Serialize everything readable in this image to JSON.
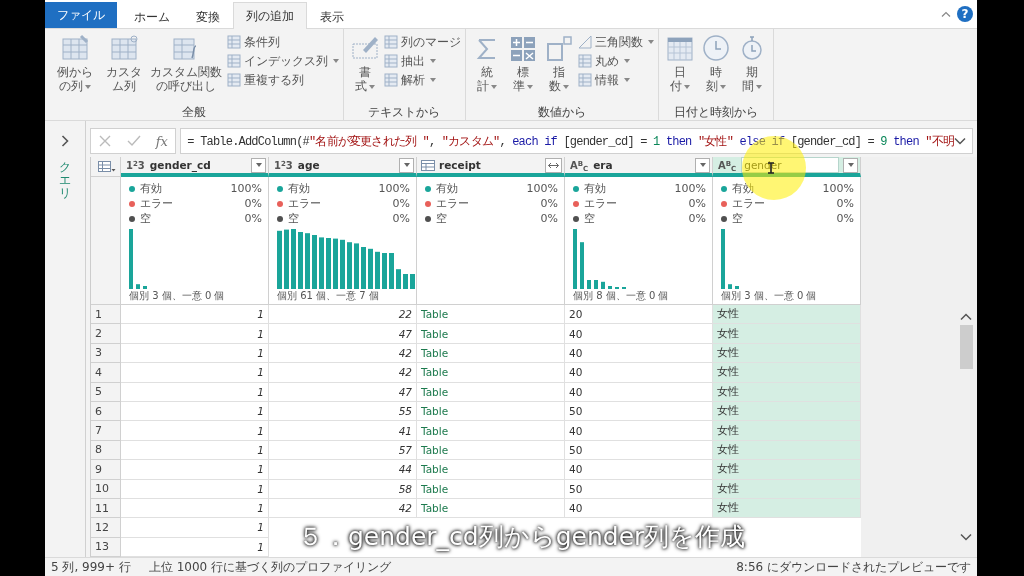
{
  "ribbon": {
    "tabs": [
      {
        "label": "ファイル",
        "kind": "file",
        "selected": false
      },
      {
        "label": "ホーム",
        "kind": "tab",
        "selected": false
      },
      {
        "label": "変換",
        "kind": "tab",
        "selected": false
      },
      {
        "label": "列の追加",
        "kind": "tab",
        "selected": true
      },
      {
        "label": "表示",
        "kind": "tab",
        "selected": false
      }
    ],
    "help_label": "?",
    "groups": [
      {
        "title": "全般",
        "items": [
          {
            "kind": "large",
            "label": "例からの列",
            "dropdown": true
          },
          {
            "kind": "large",
            "label": "カスタム列",
            "dropdown": false
          },
          {
            "kind": "large",
            "label": "カスタム関数の呼び出し",
            "dropdown": false
          },
          {
            "kind": "small",
            "label": "条件列",
            "dropdown": false
          },
          {
            "kind": "small",
            "label": "インデックス列",
            "dropdown": true
          },
          {
            "kind": "small",
            "label": "重複する列",
            "dropdown": false
          }
        ]
      },
      {
        "title": "テキストから",
        "items": [
          {
            "kind": "large",
            "label": "書式",
            "dropdown": true
          },
          {
            "kind": "small",
            "label": "列のマージ",
            "dropdown": false
          },
          {
            "kind": "small",
            "label": "抽出",
            "dropdown": true
          },
          {
            "kind": "small",
            "label": "解析",
            "dropdown": true
          }
        ]
      },
      {
        "title": "数値から",
        "items": [
          {
            "kind": "large",
            "label": "統計",
            "dropdown": true
          },
          {
            "kind": "large",
            "label": "標準",
            "dropdown": true
          },
          {
            "kind": "large",
            "label": "指数",
            "dropdown": true
          },
          {
            "kind": "small",
            "label": "三角関数",
            "dropdown": true
          },
          {
            "kind": "small",
            "label": "丸め",
            "dropdown": true
          },
          {
            "kind": "small",
            "label": "情報",
            "dropdown": true
          }
        ]
      },
      {
        "title": "日付と時刻から",
        "items": [
          {
            "kind": "large",
            "label": "日付",
            "dropdown": true
          },
          {
            "kind": "large",
            "label": "時刻",
            "dropdown": true
          },
          {
            "kind": "large",
            "label": "期間",
            "dropdown": true
          }
        ]
      }
    ]
  },
  "queries_pane": {
    "label": "クエリ"
  },
  "formula_bar": {
    "fx_label": "fx",
    "formula": "= Table.AddColumn(#\"名前が変更された列 \", \"カスタム\", each if [gender_cd] = 1 then \"女性\" else if [gender_cd] = 9 then \"不明"
  },
  "table": {
    "columns": [
      {
        "name": "gender_cd",
        "kind": "number",
        "type_label": "1$^{2}$3",
        "editing": false,
        "highlighted": false,
        "stats": [
          {
            "label": "有効",
            "value": "100%",
            "color": "#1aa59a"
          },
          {
            "label": "エラー",
            "value": "0%",
            "color": "#e8605a"
          },
          {
            "label": "空",
            "value": "0%",
            "color": "#505050"
          }
        ],
        "distinct": "個別 3 個、一意 0 個"
      },
      {
        "name": "age",
        "kind": "number",
        "type_label": "1$^{2}$3",
        "editing": false,
        "highlighted": false,
        "stats": [
          {
            "label": "有効",
            "value": "100%",
            "color": "#1aa59a"
          },
          {
            "label": "エラー",
            "value": "0%",
            "color": "#e8605a"
          },
          {
            "label": "空",
            "value": "0%",
            "color": "#505050"
          }
        ],
        "distinct": "個別 61 個、一意 7 個"
      },
      {
        "name": "receipt",
        "kind": "table",
        "editing": false,
        "highlighted": false,
        "stats": [
          {
            "label": "有効",
            "value": "100%",
            "color": "#1aa59a"
          },
          {
            "label": "エラー",
            "value": "0%",
            "color": "#e8605a"
          },
          {
            "label": "空",
            "value": "0%",
            "color": "#505050"
          }
        ]
      },
      {
        "name": "era",
        "kind": "text",
        "type_label": "A$^{B}$$_{C}$",
        "editing": false,
        "highlighted": false,
        "stats": [
          {
            "label": "有効",
            "value": "100%",
            "color": "#1aa59a"
          },
          {
            "label": "エラー",
            "value": "0%",
            "color": "#e8605a"
          },
          {
            "label": "空",
            "value": "0%",
            "color": "#505050"
          }
        ],
        "distinct": "個別 8 個、一意 0 個"
      },
      {
        "name": "gender",
        "kind": "text",
        "type_label": "A$^{B}$$_{C}$",
        "editing": true,
        "highlighted": true,
        "stats": [
          {
            "label": "有効",
            "value": "100%",
            "color": "#1aa59a"
          },
          {
            "label": "エラー",
            "value": "0%",
            "color": "#e8605a"
          },
          {
            "label": "空",
            "value": "0%",
            "color": "#505050"
          }
        ],
        "distinct": "個別 3 個、一意 0 個"
      }
    ],
    "rows": [
      {
        "number": "1",
        "cells": [
          "1",
          "22",
          "Table",
          "20",
          "女性"
        ]
      },
      {
        "number": "2",
        "cells": [
          "1",
          "47",
          "Table",
          "40",
          "女性"
        ]
      },
      {
        "number": "3",
        "cells": [
          "1",
          "42",
          "Table",
          "40",
          "女性"
        ]
      },
      {
        "number": "4",
        "cells": [
          "1",
          "42",
          "Table",
          "40",
          "女性"
        ]
      },
      {
        "number": "5",
        "cells": [
          "1",
          "47",
          "Table",
          "40",
          "女性"
        ]
      },
      {
        "number": "6",
        "cells": [
          "1",
          "55",
          "Table",
          "50",
          "女性"
        ]
      },
      {
        "number": "7",
        "cells": [
          "1",
          "41",
          "Table",
          "40",
          "女性"
        ]
      },
      {
        "number": "8",
        "cells": [
          "1",
          "57",
          "Table",
          "50",
          "女性"
        ]
      },
      {
        "number": "9",
        "cells": [
          "1",
          "44",
          "Table",
          "40",
          "女性"
        ]
      },
      {
        "number": "10",
        "cells": [
          "1",
          "58",
          "Table",
          "50",
          "女性"
        ]
      },
      {
        "number": "11",
        "cells": [
          "1",
          "42",
          "Table",
          "40",
          "女性"
        ]
      },
      {
        "number": "12",
        "cells": [
          "1",
          "",
          "",
          "",
          ""
        ]
      },
      {
        "number": "13",
        "cells": [
          "1",
          "",
          "",
          "",
          ""
        ]
      }
    ]
  },
  "status_bar": {
    "columns_rows": "5 列, 999+ 行",
    "profiling": "上位 1000 行に基づく列のプロファイリング",
    "preview": "8:56 にダウンロードされたプレビューです"
  },
  "subtitle": "５．gender_cd列からgender列を作成"
}
